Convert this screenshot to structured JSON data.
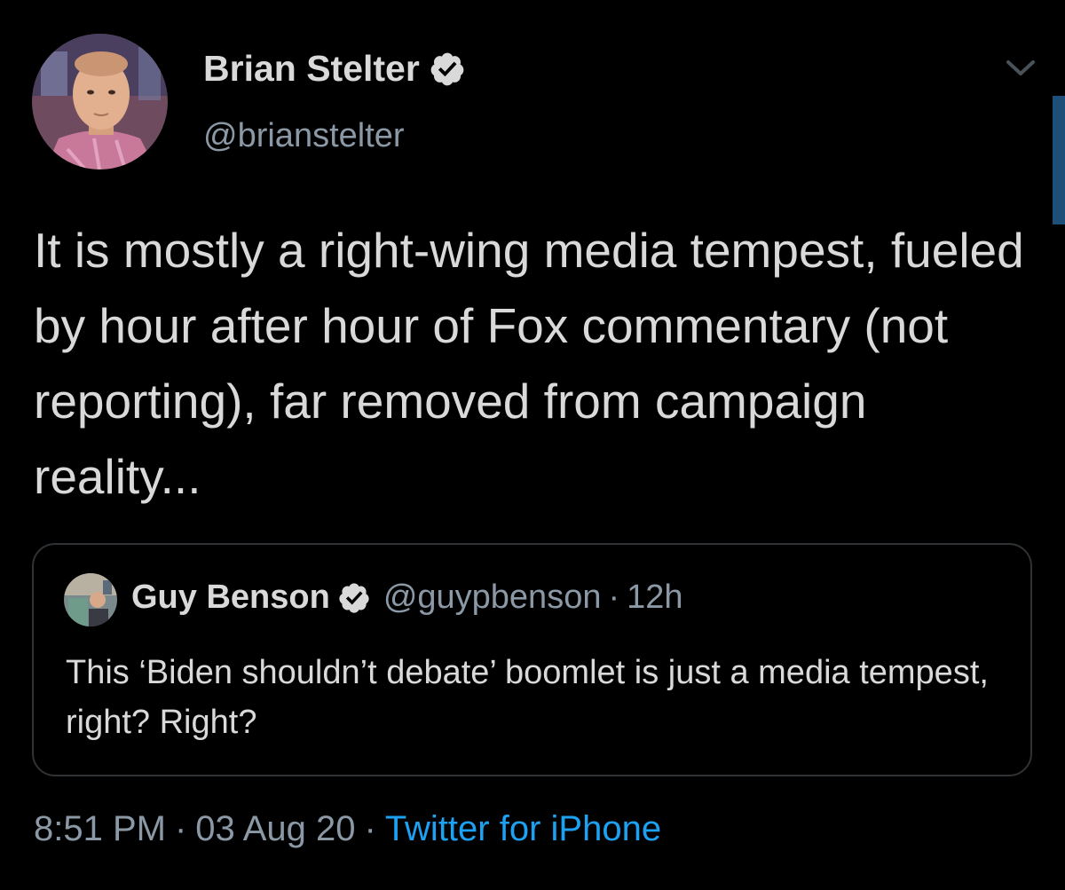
{
  "author": {
    "name": "Brian Stelter",
    "handle": "@brianstelter",
    "verified": true,
    "avatar_icon": "profile-photo"
  },
  "tweet": {
    "text": "It is mostly a right-wing media tempest, fueled by hour after hour of Fox commentary (not reporting), far removed from campaign reality..."
  },
  "quoted_tweet": {
    "name": "Guy Benson",
    "handle": "@guypbenson",
    "separator": "·",
    "time": "12h",
    "verified": true,
    "text": "This ‘Biden shouldn’t debate’ boomlet is just a media tempest, right? Right?"
  },
  "meta": {
    "time": "8:51 PM",
    "separator": "·",
    "date": "03 Aug 20",
    "source": "Twitter for iPhone"
  },
  "colors": {
    "background": "#000000",
    "text": "#d9d9d9",
    "secondary": "#8b98a5",
    "accent": "#1da1f2",
    "border": "#2f3336"
  },
  "icons": {
    "verified": "verified-badge-icon",
    "menu": "chevron-down-icon"
  }
}
